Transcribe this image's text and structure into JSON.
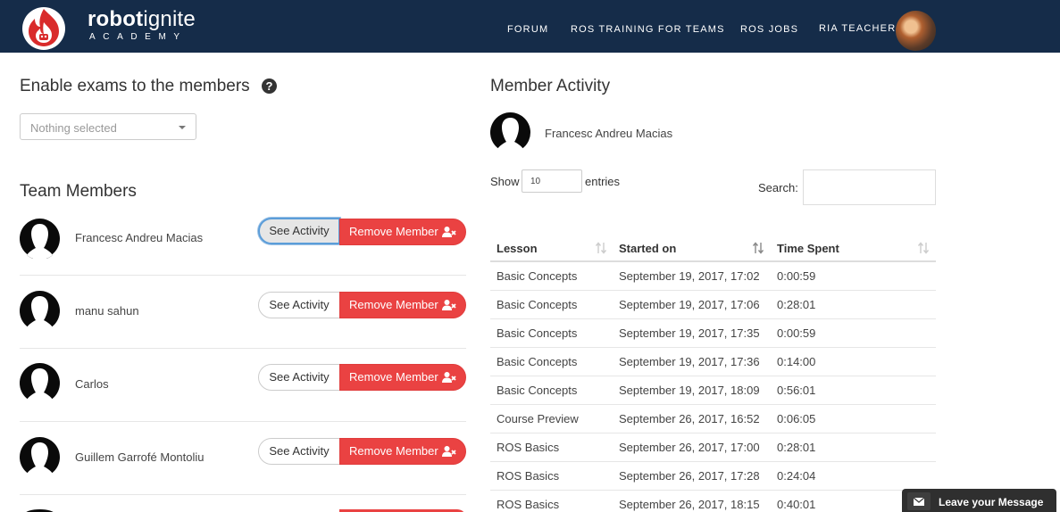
{
  "nav": {
    "logo_word_bold": "robot",
    "logo_word_light": "ignite",
    "logo_sub": "ACADEMY",
    "links": [
      "FORUM",
      "ROS TRAINING FOR TEAMS",
      "ROS JOBS",
      "RIA TEACHER"
    ]
  },
  "exams": {
    "title": "Enable exams to the members",
    "select_placeholder": "Nothing selected"
  },
  "team": {
    "title": "Team Members",
    "see_label": "See Activity",
    "remove_label": "Remove Member",
    "members": [
      "Francesc Andreu Macias",
      "manu sahun",
      "Carlos",
      "Guillem Garrofé Montoliu"
    ]
  },
  "activity": {
    "title": "Member Activity",
    "member_name": "Francesc Andreu Macias",
    "show_label": "Show",
    "entries_value": "10",
    "entries_label": "entries",
    "search_label": "Search:",
    "columns": [
      "Lesson",
      "Started on",
      "Time Spent"
    ],
    "rows": [
      [
        "Basic Concepts",
        "September 19, 2017, 17:02",
        "0:00:59"
      ],
      [
        "Basic Concepts",
        "September 19, 2017, 17:06",
        "0:28:01"
      ],
      [
        "Basic Concepts",
        "September 19, 2017, 17:35",
        "0:00:59"
      ],
      [
        "Basic Concepts",
        "September 19, 2017, 17:36",
        "0:14:00"
      ],
      [
        "Basic Concepts",
        "September 19, 2017, 18:09",
        "0:56:01"
      ],
      [
        "Course Preview",
        "September 26, 2017, 16:52",
        "0:06:05"
      ],
      [
        "ROS Basics",
        "September 26, 2017, 17:00",
        "0:28:01"
      ],
      [
        "ROS Basics",
        "September 26, 2017, 17:28",
        "0:24:04"
      ],
      [
        "ROS Basics",
        "September 26, 2017, 18:15",
        "0:40:01"
      ]
    ]
  },
  "chat": {
    "label": "Leave your Message"
  },
  "colors": {
    "navbar": "#152c49",
    "danger": "#ea4242",
    "focus": "#5b9dd9",
    "chat": "#2f2f2f"
  }
}
